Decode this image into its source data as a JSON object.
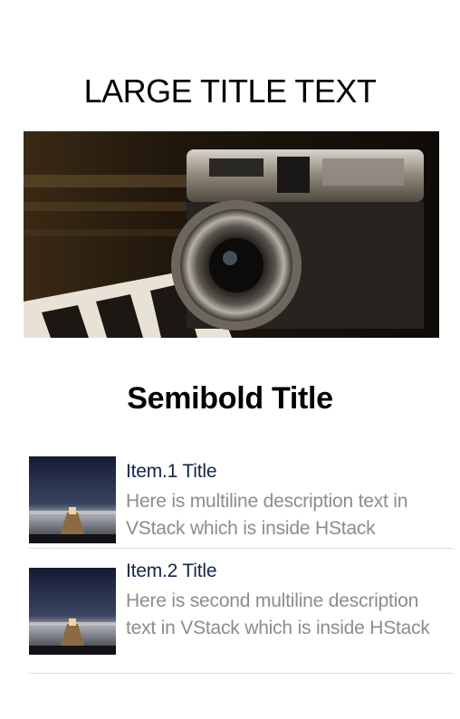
{
  "header": {
    "large_title": "LARGE TITLE TEXT"
  },
  "hero": {
    "image": "camera-photo"
  },
  "section": {
    "semibold_title": "Semibold Title"
  },
  "list": {
    "items": [
      {
        "title": "Item.1 Title",
        "description": "Here is multiline description text in VStack which is inside HStack",
        "thumbnail": "pier-photo"
      },
      {
        "title": "Item.2 Title",
        "description": "Here is second multiline description text in VStack which is inside HStack",
        "thumbnail": "pier-photo"
      }
    ]
  },
  "colors": {
    "item_title": "#132647",
    "item_description": "#8c8c8c",
    "divider": "#d9d9d9"
  }
}
